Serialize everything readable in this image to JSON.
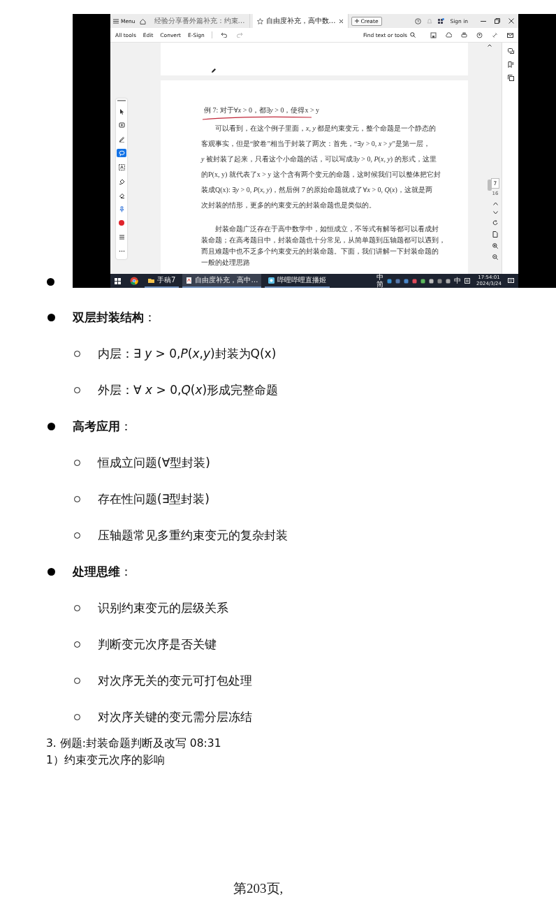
{
  "screenshot": {
    "title_bar": {
      "menu": "Menu",
      "tabs": [
        {
          "label": "经验分享番外篇补充：约束…",
          "selected": false
        },
        {
          "label": "自由度补充，高中数…",
          "selected": true
        }
      ],
      "create": "Create",
      "sign_in": "Sign in"
    },
    "toolbar": {
      "items": [
        "All tools",
        "Edit",
        "Convert",
        "E-Sign"
      ],
      "search": "Find text or tools"
    },
    "tools": [
      {
        "kind": "pointer",
        "selected": false
      },
      {
        "kind": "comment",
        "selected": false
      },
      {
        "kind": "pen",
        "selected": false
      },
      {
        "kind": "lasso",
        "selected": true
      },
      {
        "kind": "textbox",
        "selected": false
      },
      {
        "kind": "fill",
        "selected": false
      },
      {
        "kind": "eraser",
        "selected": false
      },
      {
        "kind": "pin",
        "selected": false
      },
      {
        "kind": "color",
        "color": "#e0242c",
        "selected": false
      },
      {
        "kind": "lines",
        "selected": false
      },
      {
        "kind": "more",
        "selected": false
      }
    ],
    "document": {
      "paragraphs": [
        {
          "kind": "title",
          "lines": [
            "例 7: 对于∀*x* > 0，都∃*y* > 0，使得x > y"
          ]
        },
        {
          "kind": "loose",
          "lines": [
            "可以看到，在这个例子里面，*x*, *y* 都是约束变元，整个命题是一个静态的",
            "客观事实，但是“胶卷”相当于封装了两次：首先，“∃*y* > 0, *x* > *y*”是第一层，",
            "*y* 被封装了起来，只看这个小命题的话，可以写成∃*y* > 0, *P*(*x*, *y*) 的形式，这里",
            "的P(x, y) 就代表了x > y 这个含有两个变元的命题，这时候我们可以整体把它封",
            "装成Q(x): ∃*y* > 0, *P*(*x*, *y*)，然后例 7 的原始命题就成了∀*x* > 0, *Q*(*x*)，这就是两",
            "次封装的情形，更多的约束变元的封装命题也是类似的。"
          ]
        },
        {
          "kind": "tight",
          "lines": [
            "封装命题广泛存在于高中数学中，如恒成立，不等式有解等都可以看成封",
            "装命题；在高考题目中，封装命题也十分常见，从简单题到压轴题都可以遇到，",
            "而且难题中也不乏多个约束变元的封装命题。下面，我们讲解一下封装命题的",
            "一般的处理思路"
          ]
        }
      ]
    },
    "page_number": "7",
    "page_count": "16",
    "taskbar": {
      "items": [
        {
          "kind": "folder",
          "label": "手稿7",
          "selected": false
        },
        {
          "kind": "pdf",
          "label": "自由度补充，高中…",
          "selected": true
        },
        {
          "kind": "app",
          "label": "哔哩哔哩直播姬",
          "selected": false
        }
      ],
      "ime": "中",
      "ime_mode": "简",
      "language": "中",
      "time": "17:54:01",
      "date": "2024/3/24"
    }
  },
  "outline": [
    {
      "label": "**双层封装结构**：",
      "children": [
        "内层：∃ *y* > 0,*P*(*x*,*y*)封装为Q(x)",
        "外层：∀ *x* > 0,*Q*(*x*)形成完整命题"
      ]
    },
    {
      "label": "**高考应用**：",
      "children": [
        "恒成立问题(∀型封装)",
        "存在性问题(∃型封装)",
        "压轴题常见多重约束变元的复杂封装"
      ]
    },
    {
      "label": "**处理思维**：",
      "children": [
        "识别约束变元的层级关系",
        "判断变元次序是否关键",
        "对次序无关的变元可打包处理",
        "对次序关键的变元需分层冻结"
      ]
    }
  ],
  "heading": "3. 例题:封装命题判断及改写 08:31",
  "subheading": "1）约束变元次序的影响",
  "footer": "第203页,"
}
